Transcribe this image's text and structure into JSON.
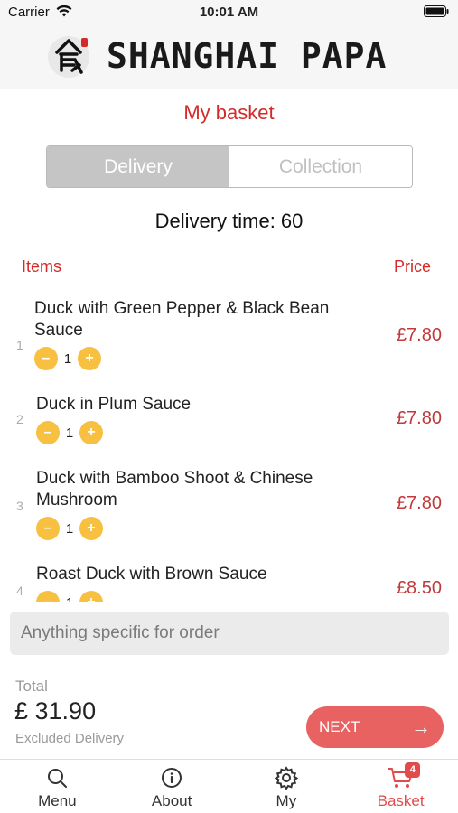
{
  "status_bar": {
    "carrier": "Carrier",
    "time": "10:01 AM"
  },
  "brand": {
    "name": "SHANGHAI PAPA",
    "logo_icon": "chinese-food-character-logo"
  },
  "page_title": "My basket",
  "order_mode": {
    "options": [
      "Delivery",
      "Collection"
    ],
    "selected": "Delivery"
  },
  "delivery_time": "Delivery time: 60",
  "columns": {
    "items": "Items",
    "price": "Price"
  },
  "basket_items": [
    {
      "index": "1",
      "name": "Duck with Green Pepper & Black Bean Sauce",
      "qty": "1",
      "price": "£7.80"
    },
    {
      "index": "2",
      "name": "Duck in Plum Sauce",
      "qty": "1",
      "price": "£7.80"
    },
    {
      "index": "3",
      "name": "Duck with Bamboo Shoot & Chinese Mushroom",
      "qty": "1",
      "price": "£7.80"
    },
    {
      "index": "4",
      "name": "Roast Duck with Brown Sauce",
      "qty": "1",
      "price": "£8.50"
    }
  ],
  "qty_controls": {
    "minus": "–",
    "plus": "+"
  },
  "note": {
    "placeholder": "Anything specific for order",
    "value": ""
  },
  "total": {
    "label": "Total",
    "value": "£ 31.90",
    "note": "Excluded Delivery"
  },
  "next_button": {
    "label": "NEXT"
  },
  "tab_bar": {
    "tabs": [
      {
        "label": "Menu",
        "icon": "search-icon"
      },
      {
        "label": "About",
        "icon": "info-icon"
      },
      {
        "label": "My",
        "icon": "gear-icon"
      },
      {
        "label": "Basket",
        "icon": "cart-icon",
        "badge": "4"
      }
    ],
    "active": "Basket"
  },
  "colors": {
    "accent_red": "#d42a2a",
    "qty_button": "#f7c040",
    "next_button": "#e96262"
  }
}
